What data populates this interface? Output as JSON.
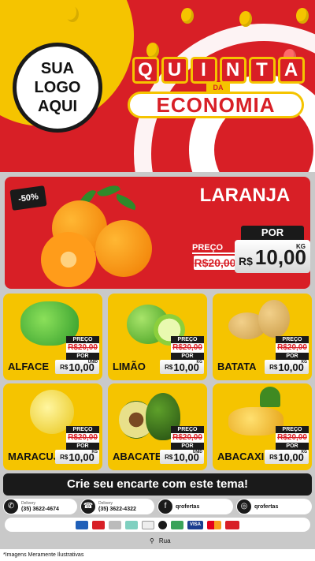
{
  "header": {
    "logo_lines": [
      "SUA",
      "LOGO",
      "AQUI"
    ],
    "title_top": [
      "Q",
      "U",
      "I",
      "N",
      "T",
      "A"
    ],
    "title_connector": "DA",
    "title_bottom": "ECONOMIA"
  },
  "featured": {
    "discount": "-50%",
    "name": "LARANJA",
    "preco_label": "PREÇO",
    "old_price": "R$20,00",
    "por_label": "POR",
    "currency": "R$",
    "price": "10,00",
    "unit": "KG"
  },
  "products": [
    {
      "name": "ALFACE",
      "preco_label": "PREÇO",
      "old_price": "R$20,00",
      "por_label": "POR",
      "currency": "R$",
      "price": "10,00",
      "unit": "UNID"
    },
    {
      "name": "LIMÃO",
      "preco_label": "PREÇO",
      "old_price": "R$20,00",
      "por_label": "POR",
      "currency": "R$",
      "price": "10,00",
      "unit": "KG"
    },
    {
      "name": "BATATA",
      "preco_label": "PREÇO",
      "old_price": "R$20,00",
      "por_label": "POR",
      "currency": "R$",
      "price": "10,00",
      "unit": "KG"
    },
    {
      "name": "MARACUJÁ",
      "preco_label": "PREÇO",
      "old_price": "R$20,00",
      "por_label": "POR",
      "currency": "R$",
      "price": "10,00",
      "unit": "KG"
    },
    {
      "name": "ABACATE",
      "preco_label": "PREÇO",
      "old_price": "R$20,00",
      "por_label": "POR",
      "currency": "R$",
      "price": "10,00",
      "unit": "UNID"
    },
    {
      "name": "ABACAXI",
      "preco_label": "PREÇO",
      "old_price": "R$20,00",
      "por_label": "POR",
      "currency": "R$",
      "price": "10,00",
      "unit": "KG"
    }
  ],
  "cta": "Crie seu encarte com este tema!",
  "contacts": [
    {
      "icon": "whatsapp-icon",
      "glyph": "✆",
      "small": "Delivery",
      "main": "(35) 3622-4674"
    },
    {
      "icon": "phone-icon",
      "glyph": "☎",
      "small": "Delivery",
      "main": "(35) 3622-4322"
    },
    {
      "icon": "facebook-icon",
      "glyph": "f",
      "small": "",
      "main": "qrofertas"
    },
    {
      "icon": "instagram-icon",
      "glyph": "◎",
      "small": "",
      "main": "qrofertas"
    }
  ],
  "payments": [
    "",
    "",
    "",
    "",
    "",
    "",
    "",
    "VISA",
    "",
    ""
  ],
  "address": "Rua",
  "footnote": "*Imagens Meramente Ilustrativas",
  "colors": {
    "red": "#d81f26",
    "yellow": "#f5c400",
    "dark": "#1a1a1a"
  }
}
